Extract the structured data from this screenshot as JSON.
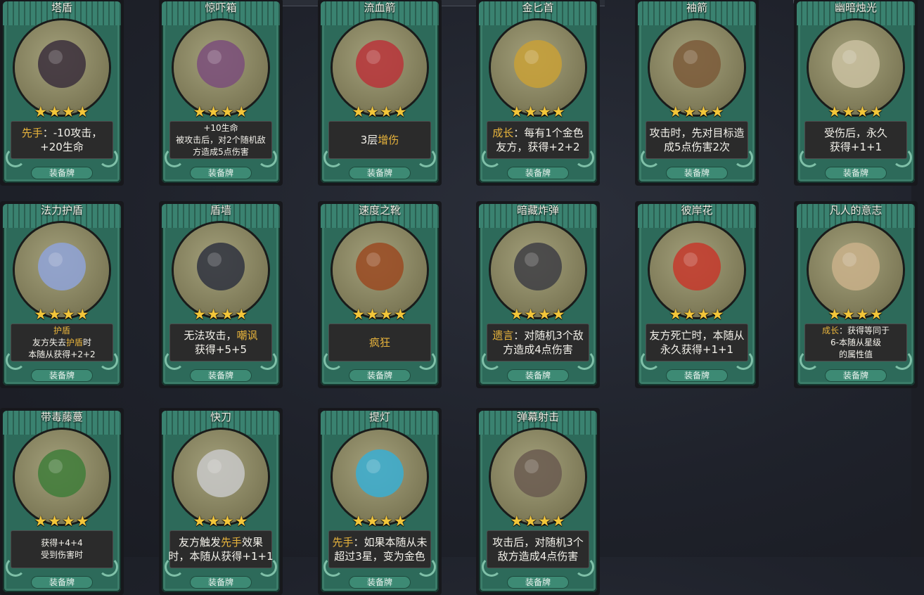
{
  "tag_label": "装备牌",
  "star_glyph": "★★★★",
  "cards": [
    {
      "name": "塔盾",
      "lines": [
        [
          "先手",
          "：-10攻击，"
        ],
        [
          "",
          "+20生命"
        ]
      ],
      "small": false
    },
    {
      "name": "惊吓箱",
      "lines": [
        [
          "",
          "+10生命"
        ],
        [
          "",
          "被攻击后，对2个随机敌"
        ],
        [
          "",
          "方造成5点伤害"
        ]
      ],
      "small": true
    },
    {
      "name": "流血箭",
      "lines": [
        [
          "",
          "3层"
        ],
        [
          "增伤",
          ""
        ]
      ],
      "small": false,
      "inline": true
    },
    {
      "name": "金匕首",
      "lines": [
        [
          "成长",
          "：每有1个金色"
        ],
        [
          "",
          "友方，获得+2+2"
        ]
      ],
      "small": false
    },
    {
      "name": "袖箭",
      "lines": [
        [
          "",
          "攻击时，先对目标造"
        ],
        [
          "",
          "成5点伤害2次"
        ]
      ],
      "small": false
    },
    {
      "name": "幽暗烛光",
      "lines": [
        [
          "",
          "受伤后，永久"
        ],
        [
          "",
          "获得+1+1"
        ]
      ],
      "small": false
    },
    {
      "name": "法力护盾",
      "lines": [
        [
          "护盾",
          ""
        ],
        [
          "",
          "友方失去"
        ],
        [
          "",
          "本随从获得+2+2"
        ]
      ],
      "small": true
    },
    {
      "name": "盾墙",
      "lines": [
        [
          "",
          "无法攻击，"
        ],
        [
          "",
          "获得+5+5"
        ]
      ],
      "small": false
    },
    {
      "name": "速度之靴",
      "lines": [
        [
          "疯狂",
          ""
        ]
      ],
      "small": false
    },
    {
      "name": "暗藏炸弹",
      "lines": [
        [
          "遗言",
          "：对随机3个敌"
        ],
        [
          "",
          "方造成4点伤害"
        ]
      ],
      "small": false
    },
    {
      "name": "彼岸花",
      "lines": [
        [
          "",
          "友方死亡时，本随从"
        ],
        [
          "",
          "永久获得+1+1"
        ]
      ],
      "small": false
    },
    {
      "name": "凡人的意志",
      "lines": [
        [
          "成长",
          "：获得等同于"
        ],
        [
          "",
          "6-本随从星级"
        ],
        [
          "",
          "的属性值"
        ]
      ],
      "small": true
    },
    {
      "name": "带毒藤蔓",
      "lines": [
        [
          "",
          "获得+4+4"
        ],
        [
          "",
          "受到伤害时"
        ]
      ],
      "small": true
    },
    {
      "name": "快刀",
      "lines": [
        [
          "",
          "友方触发"
        ],
        [
          "",
          "时，本随从获得+1+1"
        ]
      ],
      "small": false
    },
    {
      "name": "提灯",
      "lines": [
        [
          "先手",
          "：如果本随从未"
        ],
        [
          "",
          "超过3星，变为金色"
        ]
      ],
      "small": false
    },
    {
      "name": "弹幕射击",
      "lines": [
        [
          "",
          "攻击后，对随机3个"
        ],
        [
          "",
          "敌方造成4点伤害"
        ]
      ],
      "small": false
    }
  ],
  "extra_highlights": {
    "mana_shield_word": "护盾",
    "shield_wall_word": "嘲讽",
    "fast_blade_word": "先手",
    "fast_blade_suffix": "效果"
  }
}
